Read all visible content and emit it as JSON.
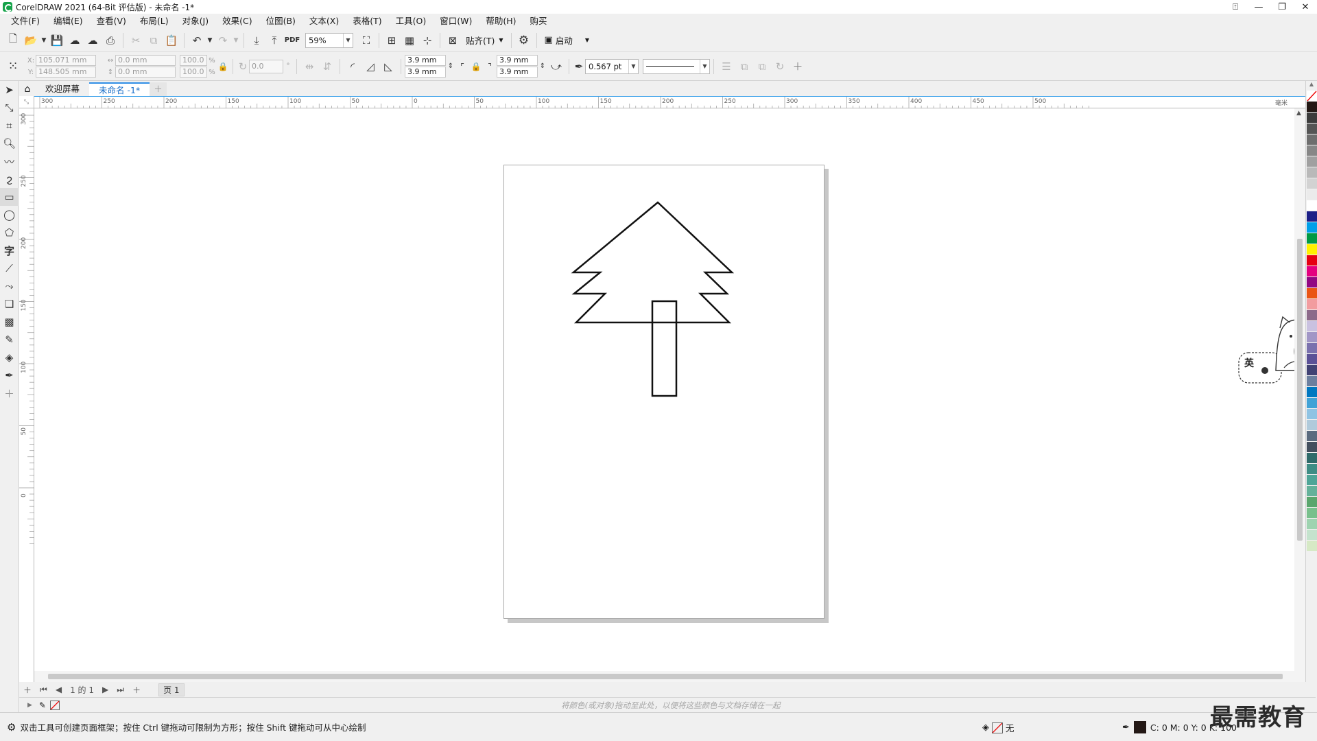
{
  "window": {
    "title": "CorelDRAW 2021 (64-Bit 评估版) - 未命名 -1*"
  },
  "menu": [
    "文件(F)",
    "编辑(E)",
    "查看(V)",
    "布局(L)",
    "对象(J)",
    "效果(C)",
    "位图(B)",
    "文本(X)",
    "表格(T)",
    "工具(O)",
    "窗口(W)",
    "帮助(H)",
    "购买"
  ],
  "toolbar": {
    "zoom": "59%",
    "snap_label": "贴齐(T)",
    "launch_label": "启动"
  },
  "property_bar": {
    "x_label": "X:",
    "y_label": "Y:",
    "x": "105.071 mm",
    "y": "148.505 mm",
    "w": "0.0 mm",
    "h": "0.0 mm",
    "scale_x": "100.0",
    "scale_y": "100.0",
    "percent": "%",
    "angle": "0.0",
    "degree": "°",
    "corner1": "3.9 mm",
    "corner2": "3.9 mm",
    "corner3": "3.9 mm",
    "corner4": "3.9 mm",
    "outline_width": "0.567 pt"
  },
  "tabs": [
    {
      "label": "欢迎屏幕",
      "active": false
    },
    {
      "label": "未命名 -1*",
      "active": true
    }
  ],
  "ruler": {
    "h_ticks": [
      "300",
      "250",
      "200",
      "150",
      "100",
      "50",
      "0",
      "50",
      "100",
      "150",
      "200",
      "250",
      "300",
      "350",
      "400",
      "450",
      "500"
    ],
    "h_unit": "毫米",
    "v_ticks": [
      "300",
      "250",
      "200",
      "150",
      "100",
      "50",
      "0"
    ]
  },
  "page_nav": {
    "current": "1",
    "of": "的",
    "total": "1",
    "page_tab": "页 1"
  },
  "doc_palette_hint": "将颜色(或对象)拖动至此处，以便将这些颜色与文档存储在一起",
  "status": {
    "message": "双击工具可创建页面框架；按住 Ctrl 键拖动可限制为方形；按住 Shift 键拖动可从中心绘制",
    "fill_label": "无",
    "outline_cmyk": "C: 0 M: 0 Y: 0 K: 100"
  },
  "ime": {
    "label": "英"
  },
  "watermark": "最需教育",
  "palette_colors": [
    "#231815",
    "#3c3c3c",
    "#555555",
    "#6e6e6e",
    "#878787",
    "#a0a0a0",
    "#b9b9b9",
    "#d2d2d2",
    "#ebebeb",
    "#ffffff",
    "#1d2088",
    "#00a0e9",
    "#009944",
    "#fff100",
    "#e60012",
    "#e4007f",
    "#920783",
    "#ea5514",
    "#f29c9f",
    "#8c6a8a",
    "#c9c1e0",
    "#a196c6",
    "#7a71ae",
    "#5b5197",
    "#414274",
    "#6c7f9f",
    "#0077c0",
    "#41a2d6",
    "#8fc3e3",
    "#b0cadb",
    "#5b6b7f",
    "#434f5e",
    "#2f6b6a",
    "#3e8d85",
    "#4ea597",
    "#64b19a",
    "#5aa66d",
    "#78c08c",
    "#9ed3b0",
    "#c4e3cd",
    "#d6e9c5"
  ]
}
